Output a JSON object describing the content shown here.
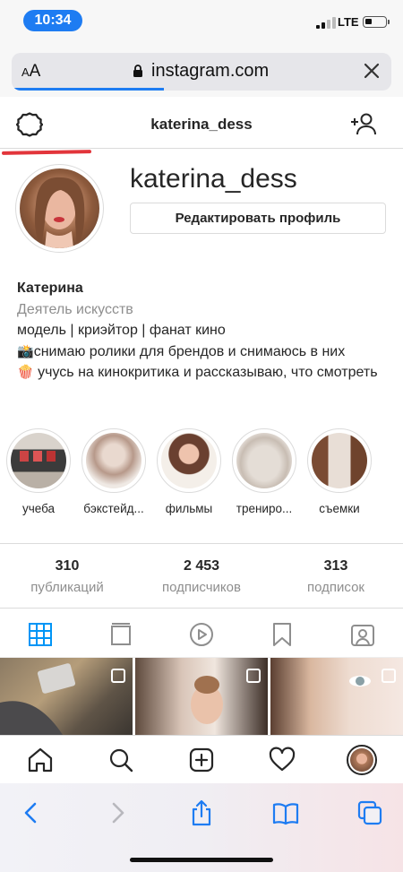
{
  "status_bar": {
    "time": "10:34",
    "network": "LTE"
  },
  "browser": {
    "text_size_label_small": "A",
    "text_size_label_large": "A",
    "url": "instagram.com"
  },
  "header": {
    "username": "katerina_dess"
  },
  "profile": {
    "username": "katerina_dess",
    "edit_button": "Редактировать профиль",
    "name": "Катерина",
    "category": "Деятель искусств",
    "bio_lines": [
      "модель | криэйтор | фанат кино",
      "снимаю ролики для брендов и снимаюсь в них",
      "учусь на кинокритика и рассказываю, что смотреть"
    ],
    "bio_emojis": [
      "📸",
      "🍿"
    ]
  },
  "highlights": [
    {
      "label": "учеба"
    },
    {
      "label": "бэкстейд..."
    },
    {
      "label": "фильмы"
    },
    {
      "label": "трениро..."
    },
    {
      "label": "съемки"
    }
  ],
  "stats": [
    {
      "value": "310",
      "label": "публикаций"
    },
    {
      "value": "2 453",
      "label": "подписчиков"
    },
    {
      "value": "313",
      "label": "подписок"
    }
  ],
  "tabs": [
    "grid-icon",
    "igtv-icon",
    "reels-icon",
    "saved-icon",
    "tagged-icon"
  ],
  "colors": {
    "accent": "#0095f6",
    "time_pill": "#1e7cf2",
    "annotation": "#e2353b",
    "muted": "#8e8e8e"
  }
}
